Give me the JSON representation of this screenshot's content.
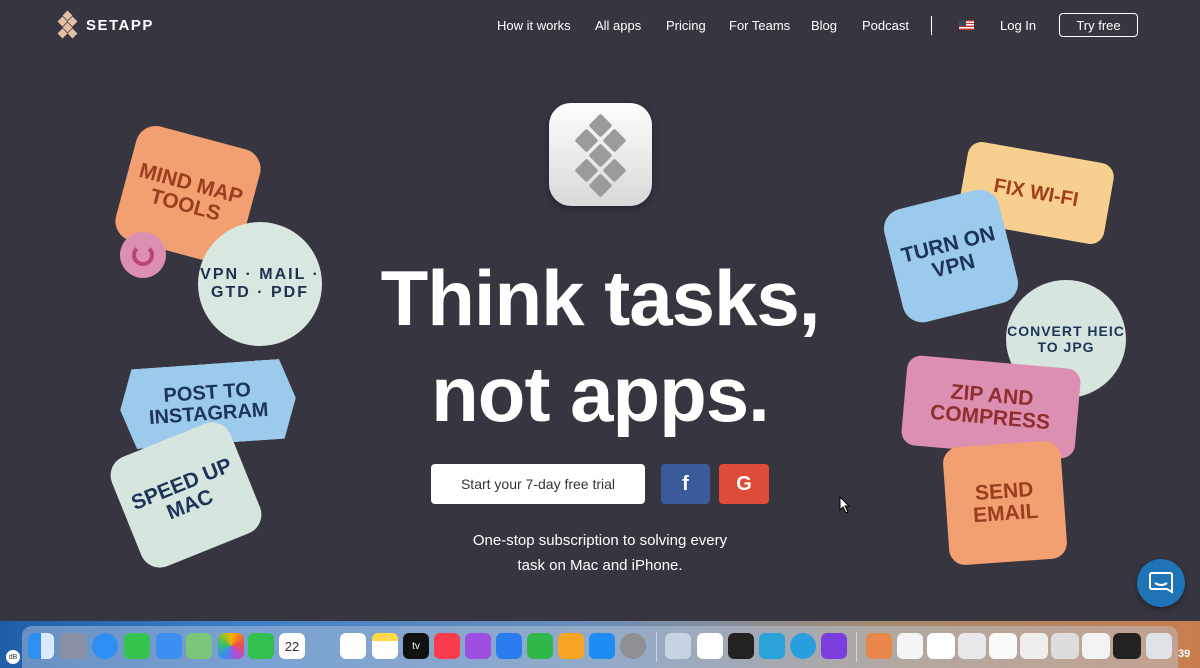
{
  "header": {
    "brand": "SETAPP",
    "nav": [
      "How it works",
      "All apps",
      "Pricing",
      "For Teams",
      "Blog",
      "Podcast"
    ],
    "login": "Log In",
    "try_free": "Try free"
  },
  "hero": {
    "headline_line1": "Think tasks,",
    "headline_line2": "not apps.",
    "trial_button": "Start your 7-day free trial",
    "facebook_label": "f",
    "google_label": "G",
    "tagline_line1": "One-stop subscription to solving every",
    "tagline_line2": "task on Mac and iPhone."
  },
  "stickers": {
    "mind_map": "Mind map tools",
    "vpn_ring": "VPN · Mail · GTD · PDF",
    "instagram": "Post to Instagram",
    "speed": "Speed up Mac",
    "wifi": "Fix Wi-Fi",
    "vpn_on": "Turn on VPN",
    "heic": "Convert HEIC to JPG",
    "zip": "Zip and compress",
    "email": "Send email"
  },
  "dock": {
    "calendar_day": "22",
    "tv_label": "tv",
    "right_number": "39"
  },
  "colors": {
    "background": "#37353f",
    "facebook": "#3b5a9a",
    "google": "#dd4b39",
    "chat": "#1f73b7"
  }
}
